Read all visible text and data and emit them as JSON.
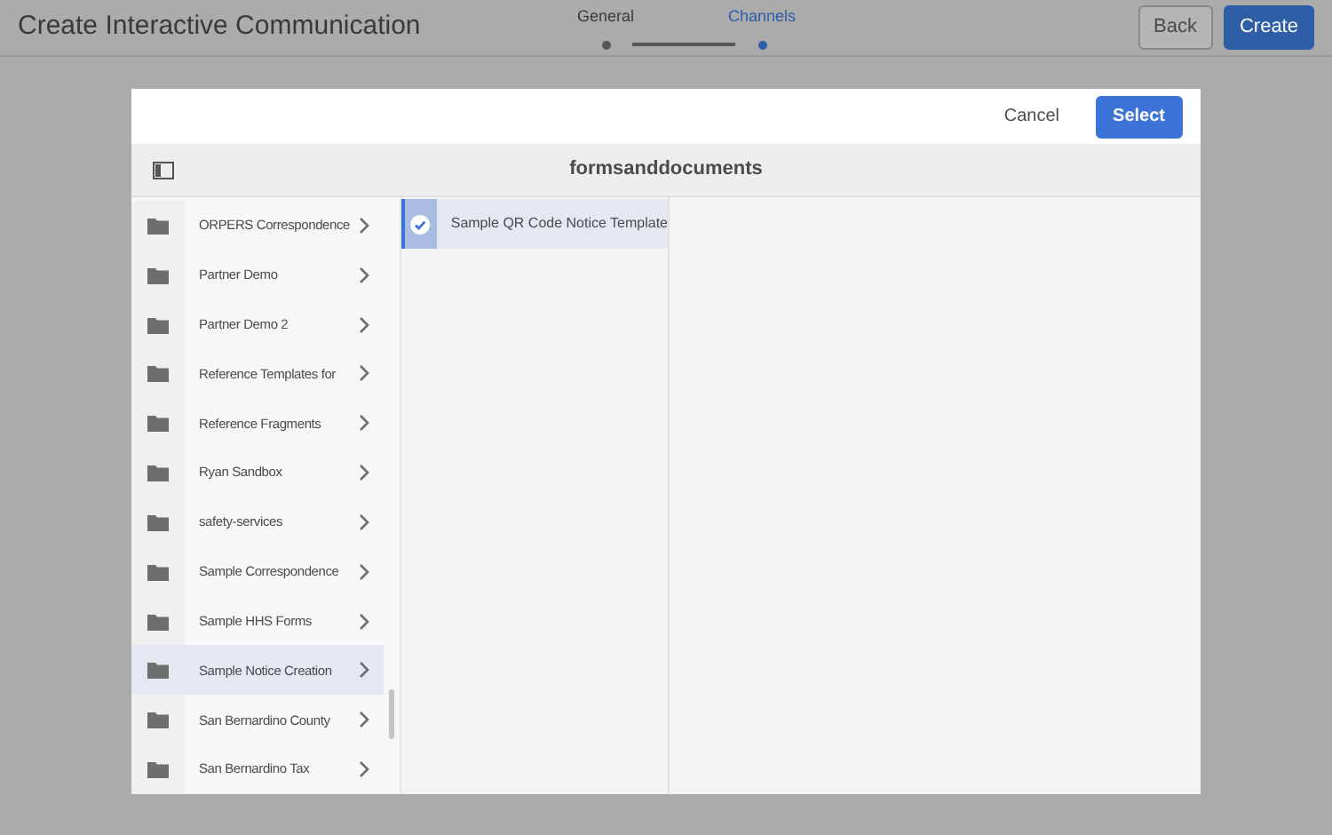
{
  "header": {
    "title": "Create Interactive Communication"
  },
  "steps": [
    {
      "label": "General",
      "selected": false
    },
    {
      "label": "Channels",
      "selected": true
    }
  ],
  "header_buttons": [
    {
      "label": "Back",
      "kind": "secondary"
    },
    {
      "label": "Create",
      "kind": "primary"
    }
  ],
  "dialog": {
    "buttons": [
      {
        "label": "Cancel",
        "kind": "quiet"
      },
      {
        "label": "Select",
        "kind": "primary"
      }
    ],
    "title": "formsanddocuments",
    "folders": [
      {
        "label": "ORPERS Correspondence",
        "selected": false
      },
      {
        "label": "Partner Demo",
        "selected": false
      },
      {
        "label": "Partner Demo 2",
        "selected": false
      },
      {
        "label": "Reference Templates for",
        "selected": false
      },
      {
        "label": "Reference Fragments",
        "selected": false
      },
      {
        "label": "Ryan Sandbox",
        "selected": false
      },
      {
        "label": "safety-services",
        "selected": false
      },
      {
        "label": "Sample Correspondence",
        "selected": false
      },
      {
        "label": "Sample HHS Forms",
        "selected": false
      },
      {
        "label": "Sample Notice Creation",
        "selected": true
      },
      {
        "label": "San Bernardino County",
        "selected": false
      },
      {
        "label": "San Bernardino Tax",
        "selected": false
      }
    ],
    "items": [
      {
        "label": "Sample QR Code Notice Template",
        "selected": true
      }
    ]
  }
}
